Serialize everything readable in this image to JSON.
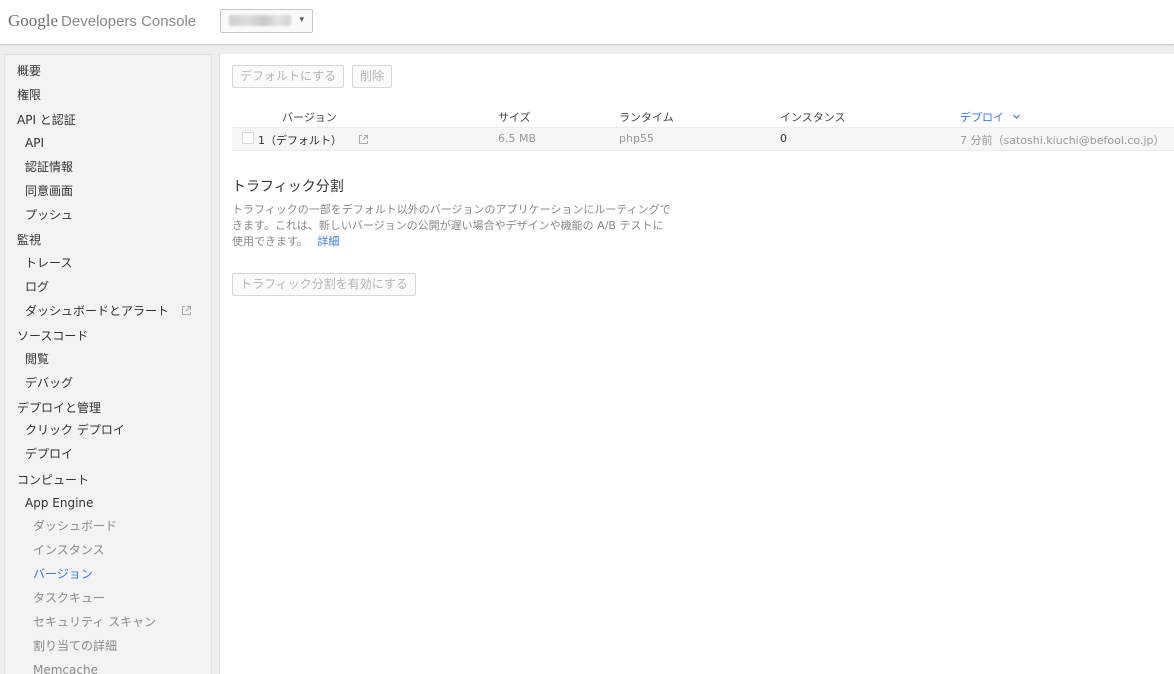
{
  "header": {
    "brand_google": "Google",
    "brand_product": "Developers Console",
    "project_caret": "▾"
  },
  "sidebar": {
    "items": [
      {
        "label": "概要",
        "level": 0
      },
      {
        "label": "権限",
        "level": 0
      },
      {
        "label": "API と認証",
        "level": 0
      },
      {
        "label": "API",
        "level": 1
      },
      {
        "label": "認証情報",
        "level": 1
      },
      {
        "label": "同意画面",
        "level": 1
      },
      {
        "label": "プッシュ",
        "level": 1
      },
      {
        "label": "監視",
        "level": 0
      },
      {
        "label": "トレース",
        "level": 1
      },
      {
        "label": "ログ",
        "level": 1
      },
      {
        "label": "ダッシュボードとアラート",
        "level": 1,
        "external": true
      },
      {
        "label": "ソースコード",
        "level": 0
      },
      {
        "label": "閲覧",
        "level": 1
      },
      {
        "label": "デバッグ",
        "level": 1
      },
      {
        "label": "デプロイと管理",
        "level": 0
      },
      {
        "label": "クリック デプロイ",
        "level": 1
      },
      {
        "label": "デプロイ",
        "level": 1
      },
      {
        "label": "コンピュート",
        "level": 0
      },
      {
        "label": "App Engine",
        "level": 1
      },
      {
        "label": "ダッシュボード",
        "level": 2
      },
      {
        "label": "インスタンス",
        "level": 2
      },
      {
        "label": "バージョン",
        "level": 2,
        "active": true
      },
      {
        "label": "タスクキュー",
        "level": 2
      },
      {
        "label": "セキュリティ スキャン",
        "level": 2
      },
      {
        "label": "割り当ての詳細",
        "level": 2
      },
      {
        "label": "Memcache",
        "level": 2
      }
    ]
  },
  "toolbar": {
    "set_default_label": "デフォルトにする",
    "delete_label": "削除"
  },
  "table": {
    "columns": [
      "バージョン",
      "サイズ",
      "ランタイム",
      "インスタンス",
      "デプロイ"
    ],
    "sorted_column": "デプロイ",
    "rows": [
      {
        "version": "1（デフォルト）",
        "size": "6.5 MB",
        "runtime": "php55",
        "instances": "0",
        "deployed": "7 分前（satoshi.kiuchi@befool.co.jp）"
      }
    ]
  },
  "traffic": {
    "title": "トラフィック分割",
    "description": "トラフィックの一部をデフォルト以外のバージョンのアプリケーションにルーティングできます。これは、新しいバージョンの公開が遅い場合やデザインや機能の A/B テストに使用できます。",
    "details_link": "詳細",
    "enable_button": "トラフィック分割を有効にする"
  },
  "colors": {
    "accent": "#3b78e7",
    "disabled_text": "#b5b5b5",
    "sidebar_bg": "#f3f3f3"
  }
}
